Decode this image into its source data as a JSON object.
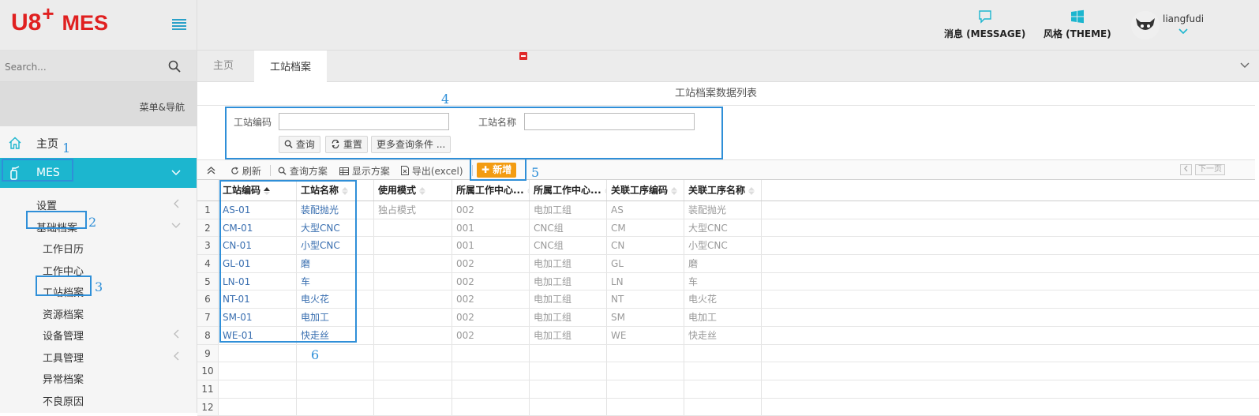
{
  "brand": {
    "logo_u8": "U8",
    "logo_plus": "+",
    "logo_mes": "MES"
  },
  "sidebar": {
    "search_placeholder": "Search...",
    "nav_title": "菜单&导航",
    "home_label": "主页",
    "mes_label": "MES",
    "items": [
      {
        "label": "设置",
        "arrow": true
      },
      {
        "label": "基础档案",
        "arrow": true
      },
      {
        "label": "工作日历"
      },
      {
        "label": "工作中心"
      },
      {
        "label": "工站档案"
      },
      {
        "label": "资源档案"
      },
      {
        "label": "设备管理",
        "arrow": true
      },
      {
        "label": "工具管理",
        "arrow": true
      },
      {
        "label": "异常档案"
      },
      {
        "label": "不良原因"
      }
    ]
  },
  "header": {
    "message_label": "消息 (MESSAGE)",
    "theme_label": "风格 (THEME)",
    "username": "liangfudi"
  },
  "tabs": [
    {
      "label": "主页"
    },
    {
      "label": "工站档案"
    }
  ],
  "content": {
    "list_title": "工站档案数据列表",
    "query": {
      "code_label": "工站编码",
      "name_label": "工站名称",
      "code_value": "",
      "name_value": "",
      "search_btn": "查询",
      "reset_btn": "重置",
      "more_btn": "更多查询条件 ..."
    },
    "toolbar": {
      "refresh": "刷新",
      "query_scheme": "查询方案",
      "display_scheme": "显示方案",
      "export": "导出(excel)",
      "add": "新增",
      "next_page": "下一页"
    },
    "grid": {
      "columns": [
        "工站编码",
        "工站名称",
        "使用模式",
        "所属工作中心...",
        "所属工作中心...",
        "关联工序编码",
        "关联工序名称"
      ],
      "rows": [
        [
          "AS-01",
          "装配抛光",
          "独占模式",
          "002",
          "电加工组",
          "AS",
          "装配抛光"
        ],
        [
          "CM-01",
          "大型CNC",
          "",
          "001",
          "CNC组",
          "CM",
          "大型CNC"
        ],
        [
          "CN-01",
          "小型CNC",
          "",
          "001",
          "CNC组",
          "CN",
          "小型CNC"
        ],
        [
          "GL-01",
          "磨",
          "",
          "002",
          "电加工组",
          "GL",
          "磨"
        ],
        [
          "LN-01",
          "车",
          "",
          "002",
          "电加工组",
          "LN",
          "车"
        ],
        [
          "NT-01",
          "电火花",
          "",
          "002",
          "电加工组",
          "NT",
          "电火花"
        ],
        [
          "SM-01",
          "电加工",
          "",
          "002",
          "电加工组",
          "SM",
          "电加工"
        ],
        [
          "WE-01",
          "快走丝",
          "",
          "002",
          "电加工组",
          "WE",
          "快走丝"
        ]
      ],
      "row_numbers": [
        "1",
        "2",
        "3",
        "4",
        "5",
        "6",
        "7",
        "8",
        "9",
        "10",
        "11",
        "12"
      ]
    }
  },
  "annotations": [
    "1",
    "2",
    "3",
    "4",
    "5",
    "6"
  ],
  "colors": {
    "accent": "#1cb6cf",
    "brand_red": "#e02020",
    "annotation": "#2f8fd8",
    "add_button": "#f39c12",
    "link": "#3a6fb0"
  }
}
